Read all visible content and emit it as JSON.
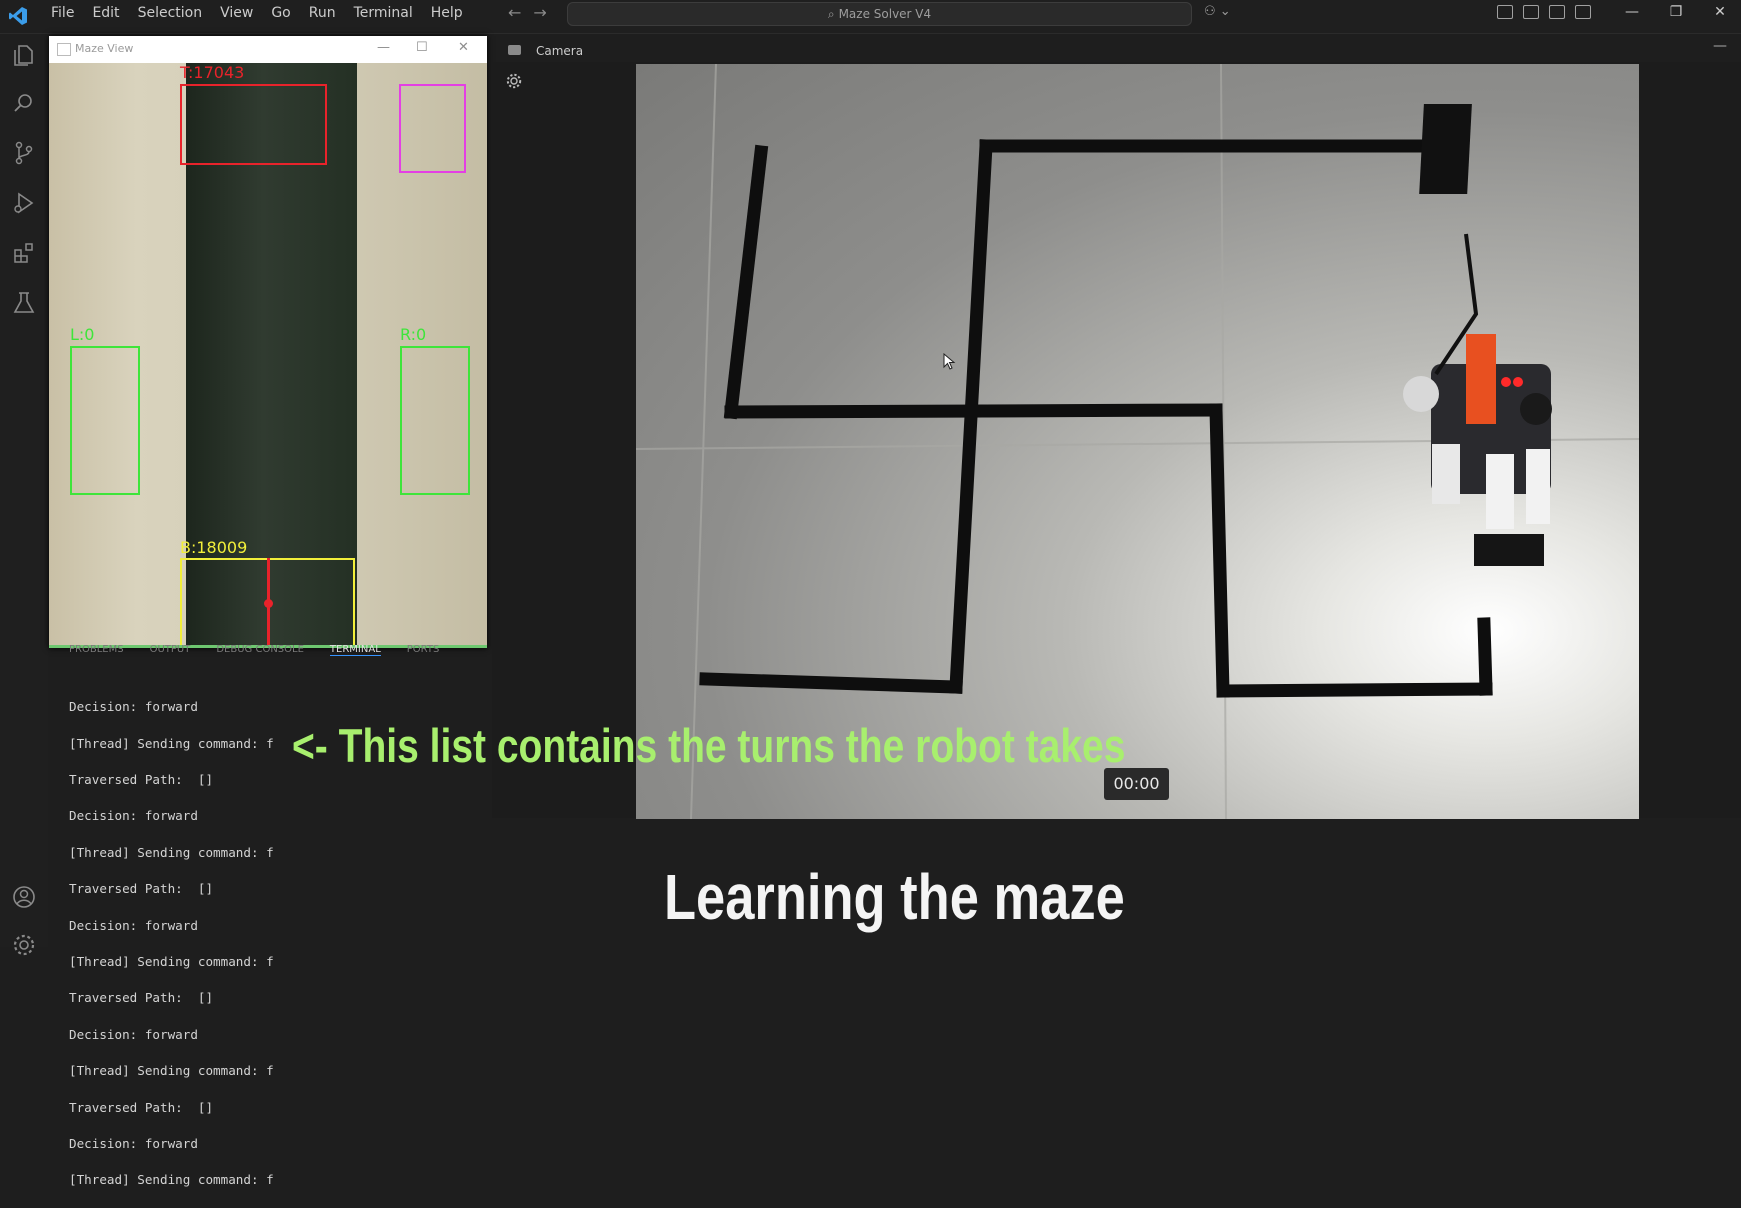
{
  "titlebar": {
    "menu": [
      "File",
      "Edit",
      "Selection",
      "View",
      "Go",
      "Run",
      "Terminal",
      "Help"
    ],
    "search_text": "Maze Solver V4",
    "window_controls": [
      "—",
      "❐",
      "✕"
    ]
  },
  "activity_bar": {
    "icons": [
      "explorer-icon",
      "search-icon",
      "source-control-icon",
      "run-debug-icon",
      "extensions-icon",
      "testing-icon",
      "account-icon",
      "settings-gear-icon"
    ]
  },
  "maze_view": {
    "title": "Maze View",
    "top_label": "T:17043",
    "left_label": "L:0",
    "right_label": "R:0",
    "bottom_label": "B:18009",
    "colors": {
      "top": "#e8232b",
      "left": "#3ee53a",
      "right": "#3ee53a",
      "bottom": "#f2ef3a",
      "corner": "#e43fe4"
    }
  },
  "panel": {
    "tabs": [
      "PROBLEMS",
      "OUTPUT",
      "DEBUG CONSOLE",
      "TERMINAL",
      "PORTS"
    ],
    "active_tab": "TERMINAL",
    "lines": [
      "Decision: forward",
      "[Thread] Sending command: f",
      "Traversed Path:  []",
      "Decision: forward",
      "[Thread] Sending command: f",
      "Traversed Path:  []",
      "Decision: forward",
      "[Thread] Sending command: f",
      "Traversed Path:  []",
      "Decision: forward",
      "[Thread] Sending command: f",
      "Traversed Path:  []",
      "Decision: forward",
      "[Thread] Sending command: f"
    ]
  },
  "camera": {
    "label": "Camera",
    "timestamp": "00:00"
  },
  "captions": {
    "annotation": "<- This list contains the turns the robot takes",
    "title": "Learning the maze"
  }
}
